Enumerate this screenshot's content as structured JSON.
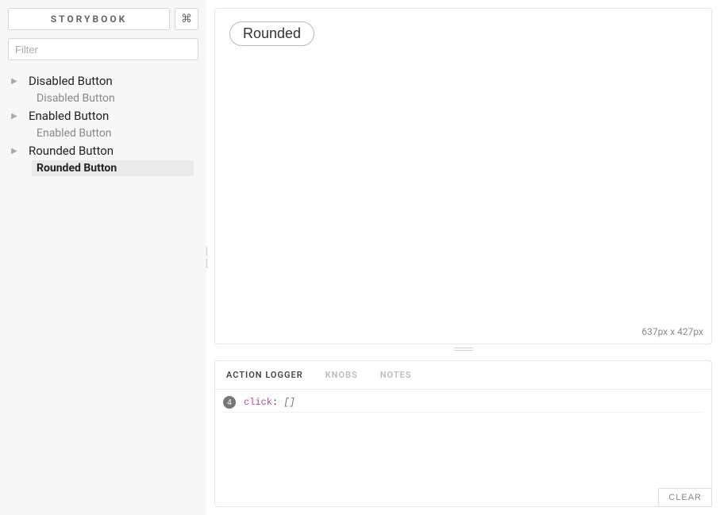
{
  "sidebar": {
    "title": "STORYBOOK",
    "shortcut_icon": "⌘",
    "filter_placeholder": "Filter",
    "groups": [
      {
        "label": "Disabled Button",
        "leaf": "Disabled Button",
        "selected": false
      },
      {
        "label": "Enabled Button",
        "leaf": "Enabled Button",
        "selected": false
      },
      {
        "label": "Rounded Button",
        "leaf": "Rounded Button",
        "selected": true
      }
    ]
  },
  "preview": {
    "button_label": "Rounded",
    "dimensions": "637px x 427px"
  },
  "addons": {
    "tabs": [
      {
        "label": "ACTION LOGGER",
        "active": true
      },
      {
        "label": "KNOBS",
        "active": false
      },
      {
        "label": "NOTES",
        "active": false
      }
    ],
    "log": {
      "count": "4",
      "event": "click",
      "colon": ":",
      "payload": "[]"
    },
    "clear_label": "CLEAR"
  }
}
